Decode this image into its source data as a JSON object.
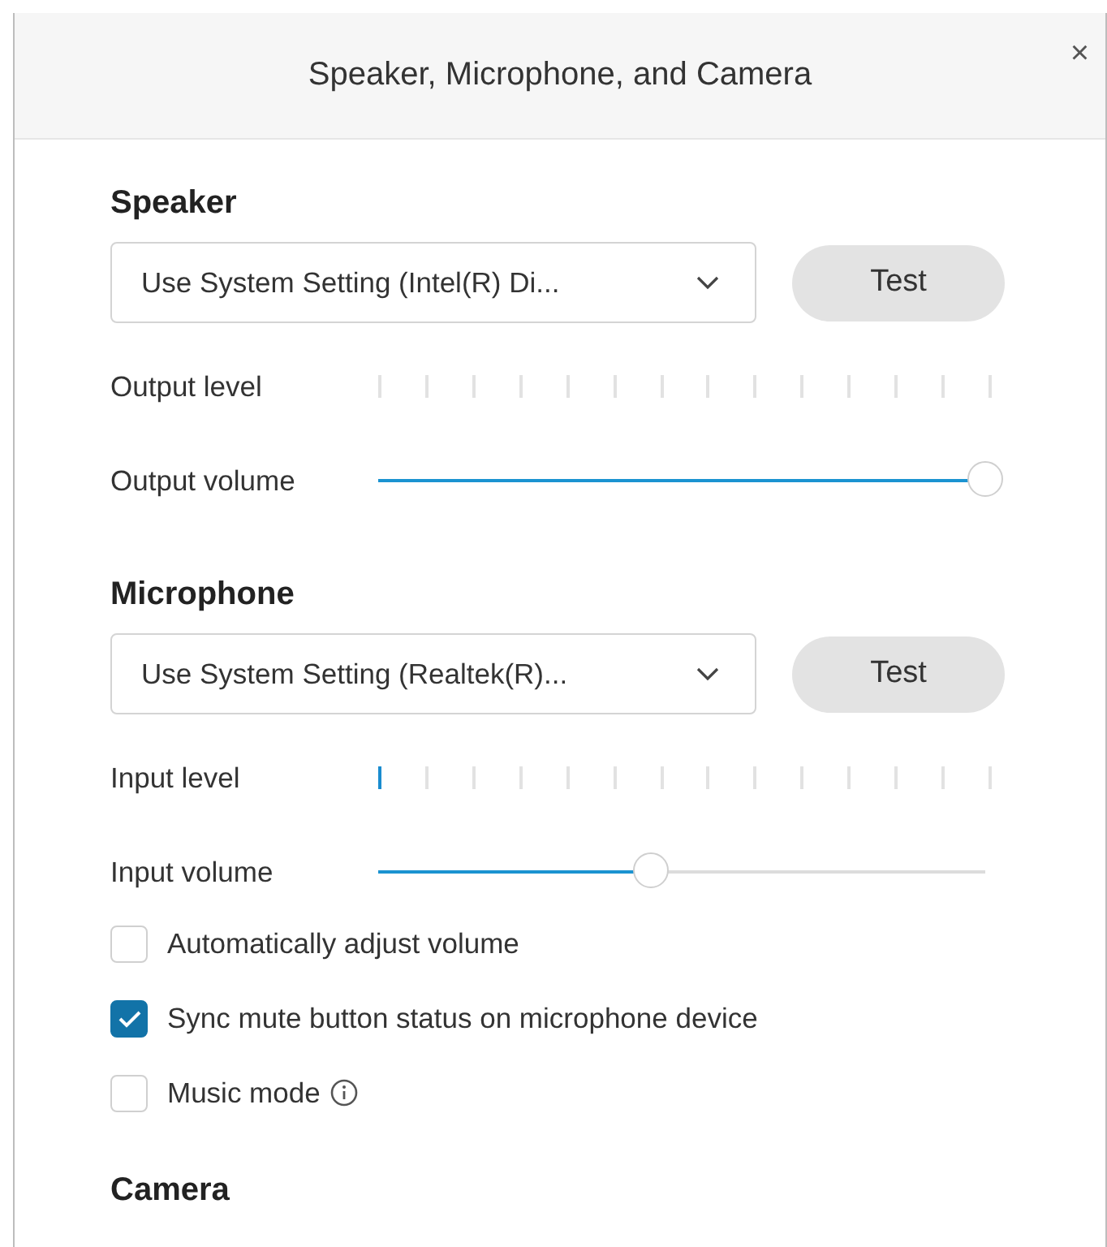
{
  "window": {
    "title": "Speaker, Microphone, and Camera",
    "close": "×"
  },
  "sections": [
    {
      "kind": "device",
      "heading": "Speaker",
      "device": "Use System Setting (Intel(R) Di...",
      "test_button": "Test",
      "meter": {
        "label": "Output level"
      },
      "volume": {
        "label": "Output volume",
        "level": 1
      }
    },
    {
      "kind": "device",
      "heading": "Microphone",
      "device": "Use System Setting (Realtek(R)...",
      "test_button": "Test",
      "meter": {
        "label": "Input level",
        "level": 0.07
      },
      "volume": {
        "label": "Input volume",
        "level": 0.45
      },
      "options": [
        {
          "label": "Automatically adjust volume",
          "checked": false,
          "info": false
        },
        {
          "label": "Sync mute button status on microphone device",
          "checked": true,
          "info": false
        },
        {
          "label": "Music mode",
          "checked": false,
          "info": true
        }
      ]
    },
    {
      "kind": "heading",
      "heading": "Camera"
    }
  ]
}
